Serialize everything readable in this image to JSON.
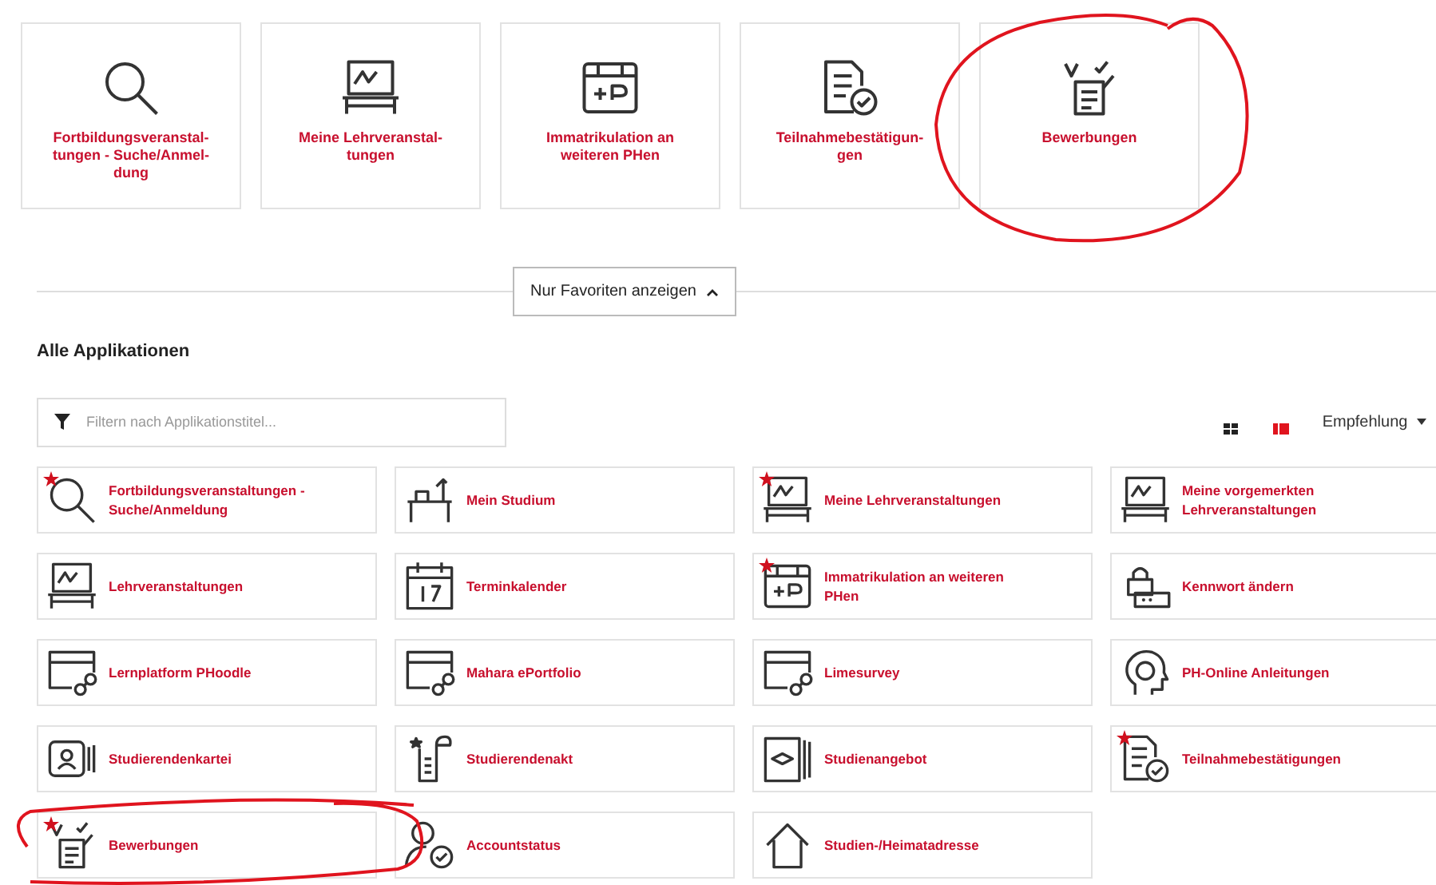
{
  "favorites": [
    {
      "label": "Fortbildungsveranstal-\ntungen - Suche/Anmel-\ndung",
      "highlighted": false
    },
    {
      "label": "Meine Lehrveranstal-\ntungen",
      "highlighted": false
    },
    {
      "label": "Immatrikulation an\nweiteren PHen",
      "highlighted": false
    },
    {
      "label": "Teilnahmebestätigun-\ngen",
      "highlighted": false
    },
    {
      "label": "Bewerbungen",
      "highlighted": true
    }
  ],
  "favorites_toggle": {
    "label": "Nur Favoriten anzeigen",
    "expanded": true
  },
  "section_title": "Alle Applikationen",
  "filter": {
    "placeholder": "Filtern nach Applikationstitel..."
  },
  "view_modes": [
    {
      "selected": false
    },
    {
      "selected": true
    }
  ],
  "sort": {
    "label": "Empfehlung"
  },
  "applications": [
    {
      "label": "Fortbildungsveranstaltungen -\nSuche/Anmeldung",
      "favorite": true,
      "highlighted": false
    },
    {
      "label": "Mein Studium",
      "favorite": false,
      "highlighted": false
    },
    {
      "label": "Meine Lehrveranstaltungen",
      "favorite": true,
      "highlighted": false
    },
    {
      "label": "Meine vorgemerkten\nLehrveranstaltungen",
      "favorite": false,
      "highlighted": false
    },
    {
      "label": "Lehrveranstaltungen",
      "favorite": false,
      "highlighted": false
    },
    {
      "label": "Terminkalender",
      "favorite": false,
      "highlighted": false
    },
    {
      "label": "Immatrikulation an weiteren\nPHen",
      "favorite": true,
      "highlighted": false
    },
    {
      "label": "Kennwort ändern",
      "favorite": false,
      "highlighted": false
    },
    {
      "label": "Lernplatform PHoodle",
      "favorite": false,
      "highlighted": false
    },
    {
      "label": "Mahara ePortfolio",
      "favorite": false,
      "highlighted": false
    },
    {
      "label": "Limesurvey",
      "favorite": false,
      "highlighted": false
    },
    {
      "label": "PH-Online Anleitungen",
      "favorite": false,
      "highlighted": false
    },
    {
      "label": "Studierendenkartei",
      "favorite": false,
      "highlighted": false
    },
    {
      "label": "Studierendenakt",
      "favorite": false,
      "highlighted": false
    },
    {
      "label": "Studienangebot",
      "favorite": false,
      "highlighted": false
    },
    {
      "label": "Teilnahmebestätigungen",
      "favorite": true,
      "highlighted": false
    },
    {
      "label": "Bewerbungen",
      "favorite": true,
      "highlighted": true
    },
    {
      "label": "Accountstatus",
      "favorite": false,
      "highlighted": false
    },
    {
      "label": "Studien-/Heimatadresse",
      "favorite": false,
      "highlighted": false
    }
  ]
}
